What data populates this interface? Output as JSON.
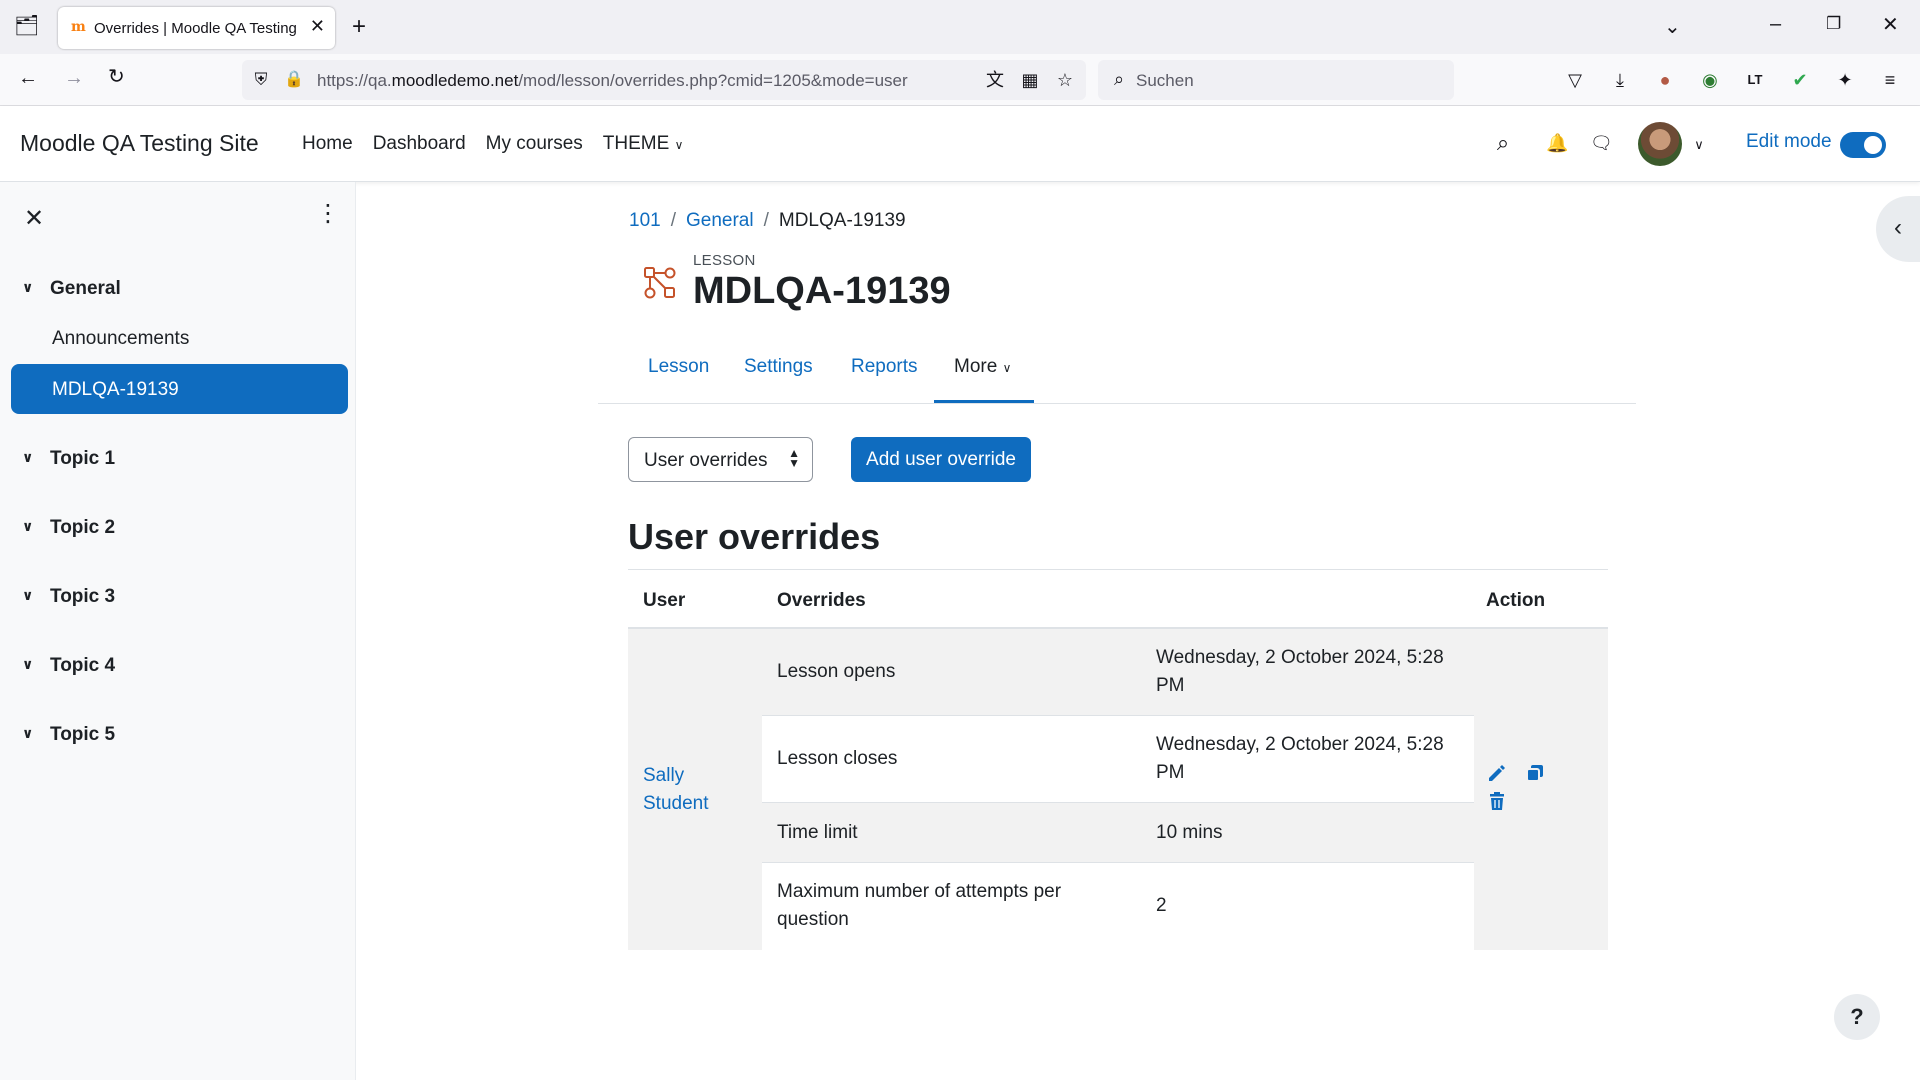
{
  "browser": {
    "tab_title": "Overrides | Moodle QA Testing Site",
    "tab_favicon": "m",
    "url_prefix": "https://qa.",
    "url_host": "moodledemo.net",
    "url_path": "/mod/lesson/overrides.php?cmid=1205&mode=user",
    "search_placeholder": "Suchen",
    "extension_label": "LT"
  },
  "header": {
    "site_name": "Moodle QA Testing Site",
    "nav": [
      "Home",
      "Dashboard",
      "My courses",
      "THEME"
    ],
    "edit_mode_label": "Edit mode",
    "edit_mode_on": true
  },
  "drawer": {
    "sections": [
      {
        "title": "General",
        "items": [
          "Announcements",
          "MDLQA-19139"
        ]
      },
      {
        "title": "Topic 1"
      },
      {
        "title": "Topic 2"
      },
      {
        "title": "Topic 3"
      },
      {
        "title": "Topic 4"
      },
      {
        "title": "Topic 5"
      }
    ],
    "active_item": "MDLQA-19139"
  },
  "breadcrumb": [
    "101",
    "General",
    "MDLQA-19139"
  ],
  "activity": {
    "type": "LESSON",
    "title": "MDLQA-19139"
  },
  "secondary_nav": [
    "Lesson",
    "Settings",
    "Reports",
    "More"
  ],
  "controls": {
    "select_value": "User overrides",
    "add_button": "Add user override"
  },
  "page_heading": "User overrides",
  "table": {
    "headers": [
      "User",
      "Overrides",
      "Action"
    ],
    "user": "Sally Student",
    "rows": [
      {
        "setting": "Lesson opens",
        "value": "Wednesday, 2 October 2024, 5:28 PM"
      },
      {
        "setting": "Lesson closes",
        "value": "Wednesday, 2 October 2024, 5:28 PM"
      },
      {
        "setting": "Time limit",
        "value": "10 mins"
      },
      {
        "setting": "Maximum number of attempts per question",
        "value": "2"
      }
    ]
  },
  "help_label": "?",
  "colors": {
    "primary": "#0f6cbf",
    "activity_icon": "#c5522a"
  }
}
